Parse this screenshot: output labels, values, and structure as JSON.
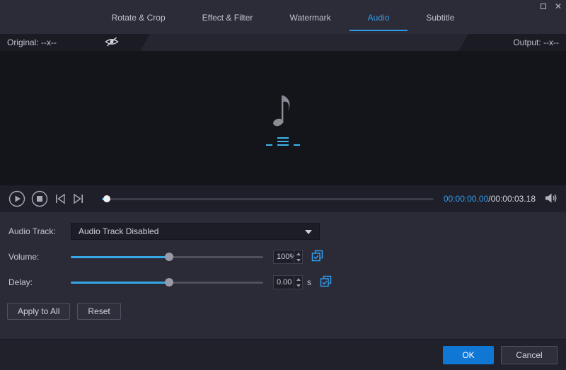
{
  "window": {
    "close_glyph": "✕"
  },
  "tabs": [
    {
      "label": "Rotate & Crop",
      "active": false
    },
    {
      "label": "Effect & Filter",
      "active": false
    },
    {
      "label": "Watermark",
      "active": false
    },
    {
      "label": "Audio",
      "active": true
    },
    {
      "label": "Subtitle",
      "active": false
    }
  ],
  "preview_header": {
    "original": "Original: --x--",
    "output": "Output: --x--"
  },
  "player": {
    "current_time": "00:00:00.00",
    "duration": "/00:00:03.18",
    "progress_pct": "1.5%"
  },
  "audio_track": {
    "label": "Audio Track:",
    "selected": "Audio Track Disabled"
  },
  "volume": {
    "label": "Volume:",
    "value": "100%",
    "slider_pct": "51%"
  },
  "delay": {
    "label": "Delay:",
    "value": "0.00",
    "unit": "s",
    "slider_pct": "51%"
  },
  "actions": {
    "apply_all": "Apply to All",
    "reset": "Reset"
  },
  "footer": {
    "ok": "OK",
    "cancel": "Cancel"
  },
  "colors": {
    "accent": "#2e9ce8",
    "slider_fill": "#37a8e6",
    "ok_button": "#1177d4",
    "eq_cyan": "#3ab6ea"
  }
}
